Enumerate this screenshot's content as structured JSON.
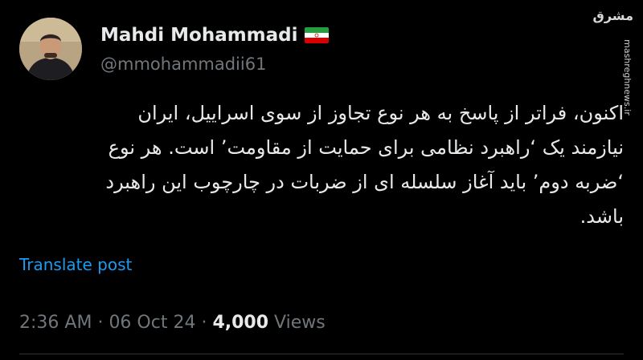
{
  "author": {
    "display_name": "Mahdi Mohammadi",
    "handle": "@mmohammadii61",
    "flag_icon": "iran-flag-icon"
  },
  "tweet": {
    "lines": [
      "اکنون، فراتر از پاسخ به هر نوع تجاوز از سوی اسراییل، ایران",
      "نیازمند یک ‘راهبرد نظامی برای حمایت از مقاومت’ است. هر نوع",
      "‘ضربه دوم’ باید آغاز سلسله ای از ضربات در چارچوب این راهبرد",
      "باشد."
    ],
    "translate_label": "Translate post"
  },
  "meta": {
    "time": "2:36 AM",
    "separator": "·",
    "date": "06 Oct 24",
    "views_count": "4,000",
    "views_label": "Views"
  },
  "watermark": {
    "logo": "مشرق",
    "url": "mashreghnews.ir"
  },
  "colors": {
    "background": "#000000",
    "text": "#e7e9ea",
    "muted": "#71767b",
    "link": "#1d9bf0",
    "divider": "#2f3336"
  }
}
